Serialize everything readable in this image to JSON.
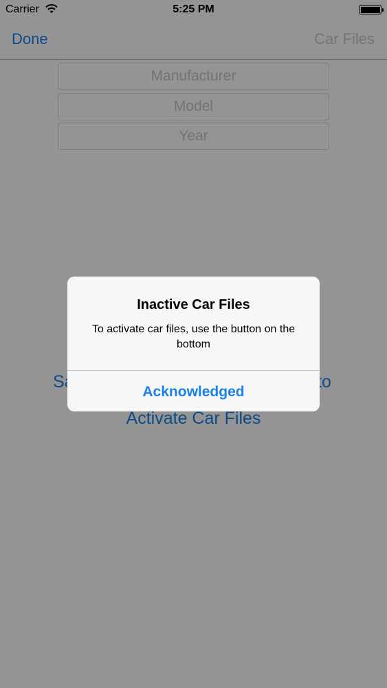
{
  "status_bar": {
    "carrier": "Carrier",
    "time": "5:25 PM",
    "wifi_icon": "wifi-icon",
    "battery_icon": "battery-icon"
  },
  "nav_bar": {
    "done_label": "Done",
    "title": "Car Files"
  },
  "fields": {
    "manufacturer_placeholder": "Manufacturer",
    "model_placeholder": "Model",
    "year_placeholder": "Year"
  },
  "body_buttons": {
    "partial_label_left": "Sa",
    "partial_label_right": "to",
    "activate_label": "Activate Car Files"
  },
  "alert": {
    "title": "Inactive Car Files",
    "message": "To activate car files, use the button on the bottom",
    "button_label": "Acknowledged"
  },
  "colors": {
    "accent": "#1b82e8",
    "overlay": "rgba(0,0,0,0.42)",
    "alert_background": "#f7f7f7"
  }
}
